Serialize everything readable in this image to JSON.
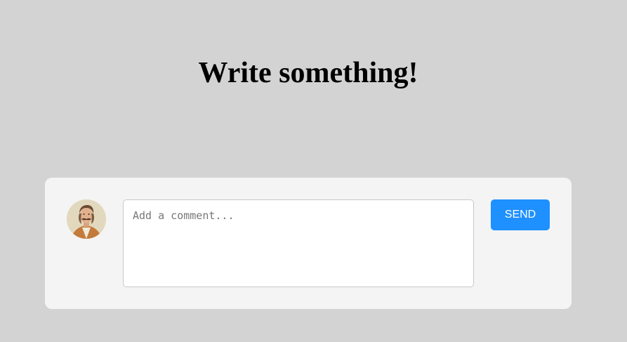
{
  "header": {
    "title": "Write something!"
  },
  "comment_form": {
    "avatar_icon": "user-portrait-avatar",
    "input": {
      "value": "",
      "placeholder": "Add a comment..."
    },
    "send_label": "SEND"
  },
  "colors": {
    "page_background": "#d3d3d3",
    "card_background": "#f4f4f4",
    "send_button": "#1e90ff",
    "send_button_text": "#ffffff"
  }
}
